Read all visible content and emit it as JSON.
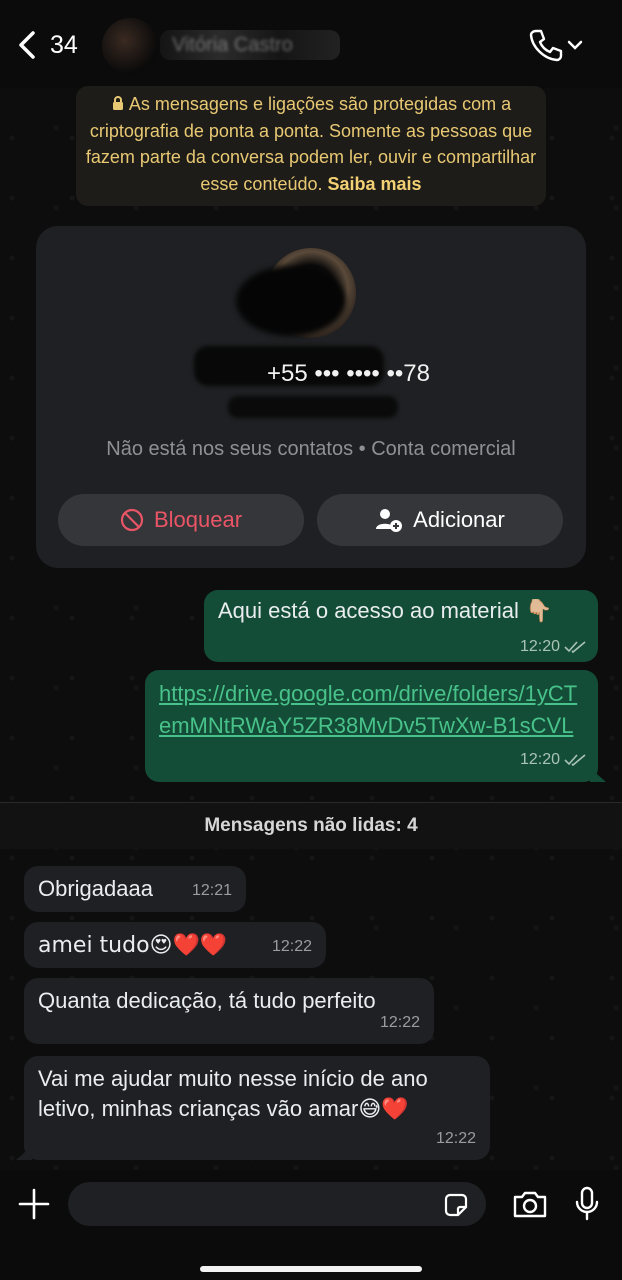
{
  "header": {
    "back_count": "34",
    "contact_name": "Vitória Castro"
  },
  "encryption_notice": {
    "text": "As mensagens e ligações são protegidas com a criptografia de ponta a ponta. Somente as pessoas que fazem parte da conversa podem ler, ouvir e compartilhar esse conteúdo.",
    "link": "Saiba mais"
  },
  "contact_card": {
    "phone_suffix": "+55 ••• •••• ••78",
    "info": "Não está nos seus contatos • Conta comercial",
    "block_label": "Bloquear",
    "add_label": "Adicionar"
  },
  "messages_out": [
    {
      "text": "Aqui está o acesso ao material 👇🏼",
      "time": "12:20"
    },
    {
      "text": "https://drive.google.com/drive/folders/1yCTemMNtRWaY5ZR38MvDv5TwXw-B1sCVL",
      "time": "12:20"
    }
  ],
  "unread_divider": "Mensagens não lidas: 4",
  "messages_in": [
    {
      "text": "Obrigadaaa",
      "time": "12:21"
    },
    {
      "text": "amei tudo😍❤️❤️",
      "time": "12:22"
    },
    {
      "text": "Quanta dedicação, tá tudo perfeito",
      "time": "12:22"
    },
    {
      "text": "Vai me ajudar muito nesse início de ano letivo, minhas crianças vão amar😅❤️",
      "time": "12:22"
    }
  ],
  "composer": {
    "placeholder": ""
  },
  "colors": {
    "outgoing_bubble": "#144d37",
    "incoming_bubble": "#1f2023",
    "block_red": "#ea5566",
    "notice_yellow": "#e8c873"
  }
}
